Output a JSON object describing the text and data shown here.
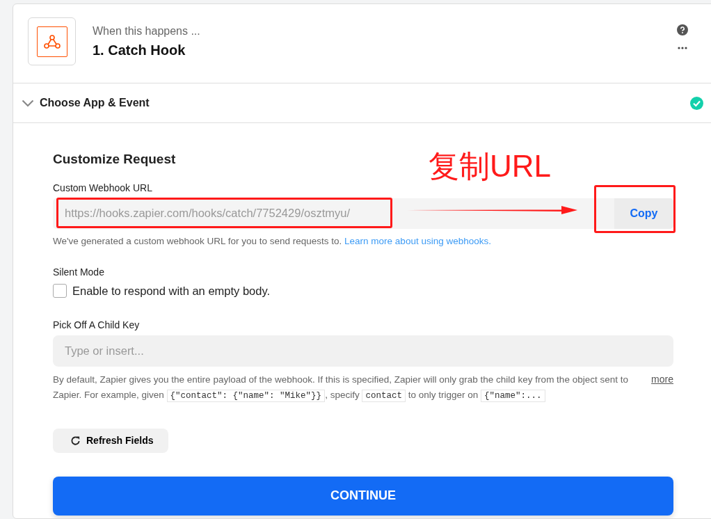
{
  "step": {
    "subtitle": "When this happens ...",
    "title": "1. Catch Hook"
  },
  "section": {
    "title": "Choose App & Event",
    "expanded": true,
    "complete": true
  },
  "form": {
    "title": "Customize Request",
    "url_field": {
      "label": "Custom Webhook URL",
      "value": "https://hooks.zapier.com/hooks/catch/7752429/osztmyu/",
      "button": "Copy",
      "help": "We've generated a custom webhook URL for you to send requests to.",
      "help_link": "Learn more about using webhooks."
    },
    "silent_mode": {
      "label": "Silent Mode",
      "checkbox_label": "Enable to respond with an empty body.",
      "checked": false
    },
    "child_key": {
      "label": "Pick Off A Child Key",
      "placeholder": "Type or insert...",
      "description": [
        {
          "kind": "text",
          "text": "By default, Zapier gives you the entire payload of the webhook. If this is specified, Zapier will only grab the child key from the object sent to Zapier. For example, given "
        },
        {
          "kind": "code",
          "text": "{\"contact\": {\"name\": \"Mike\"}}"
        },
        {
          "kind": "text",
          "text": ", specify "
        },
        {
          "kind": "code",
          "text": "contact"
        },
        {
          "kind": "text",
          "text": " to only trigger on "
        },
        {
          "kind": "code",
          "text": "{\"name\":..."
        }
      ],
      "more": "more"
    },
    "refresh_button": "Refresh Fields",
    "continue_button": "CONTINUE"
  },
  "annotation": {
    "text": "复制URL"
  }
}
